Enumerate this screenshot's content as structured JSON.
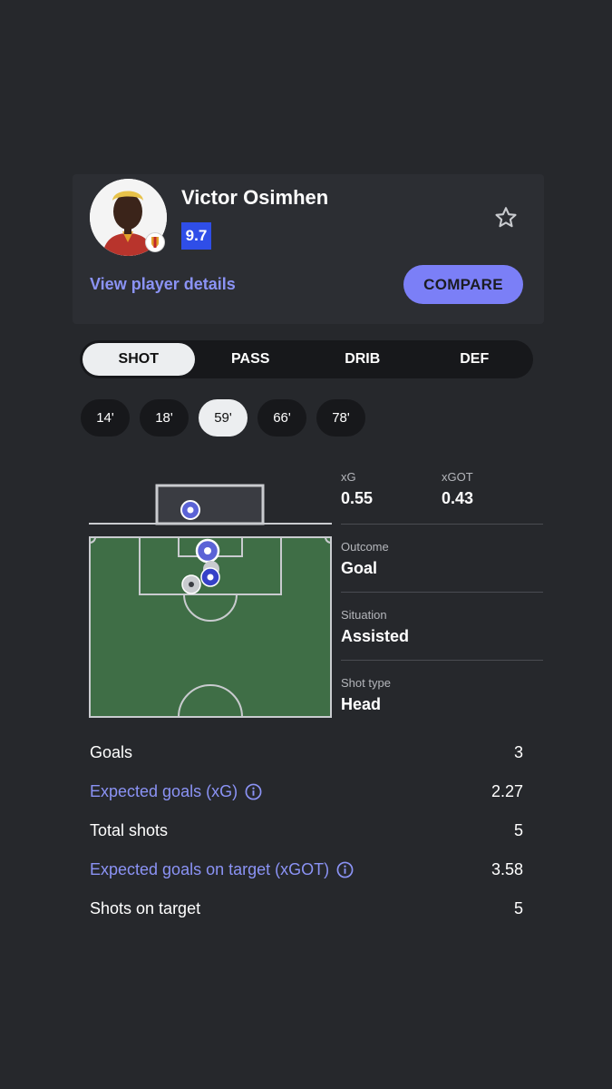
{
  "player": {
    "name": "Victor Osimhen",
    "rating": "9.7",
    "details_link": "View player details",
    "compare_label": "COMPARE"
  },
  "icons": {
    "star": "star-outline-icon",
    "info": "info-circle-icon",
    "ball": "football-icon"
  },
  "colors": {
    "accent": "#7b7ff7",
    "link": "#8b93f5",
    "rating": "#2f4ee8",
    "pitch": "#3f6e46",
    "background": "#26282c"
  },
  "tabs": [
    {
      "label": "SHOT",
      "active": true
    },
    {
      "label": "PASS",
      "active": false
    },
    {
      "label": "DRIB",
      "active": false
    },
    {
      "label": "DEF",
      "active": false
    }
  ],
  "minutes": [
    {
      "label": "14'",
      "active": false
    },
    {
      "label": "18'",
      "active": false
    },
    {
      "label": "59'",
      "active": true
    },
    {
      "label": "66'",
      "active": false
    },
    {
      "label": "78'",
      "active": false
    }
  ],
  "shot": {
    "xg_label": "xG",
    "xg_value": "0.55",
    "xgot_label": "xGOT",
    "xgot_value": "0.43",
    "outcome_label": "Outcome",
    "outcome_value": "Goal",
    "situation_label": "Situation",
    "situation_value": "Assisted",
    "shot_type_label": "Shot type",
    "shot_type_value": "Head"
  },
  "summary": [
    {
      "label": "Goals",
      "value": "3",
      "info": false
    },
    {
      "label": "Expected goals (xG)",
      "value": "2.27",
      "info": true
    },
    {
      "label": "Total shots",
      "value": "5",
      "info": false
    },
    {
      "label": "Expected goals on target (xGOT)",
      "value": "3.58",
      "info": true
    },
    {
      "label": "Shots on target",
      "value": "5",
      "info": false
    }
  ]
}
